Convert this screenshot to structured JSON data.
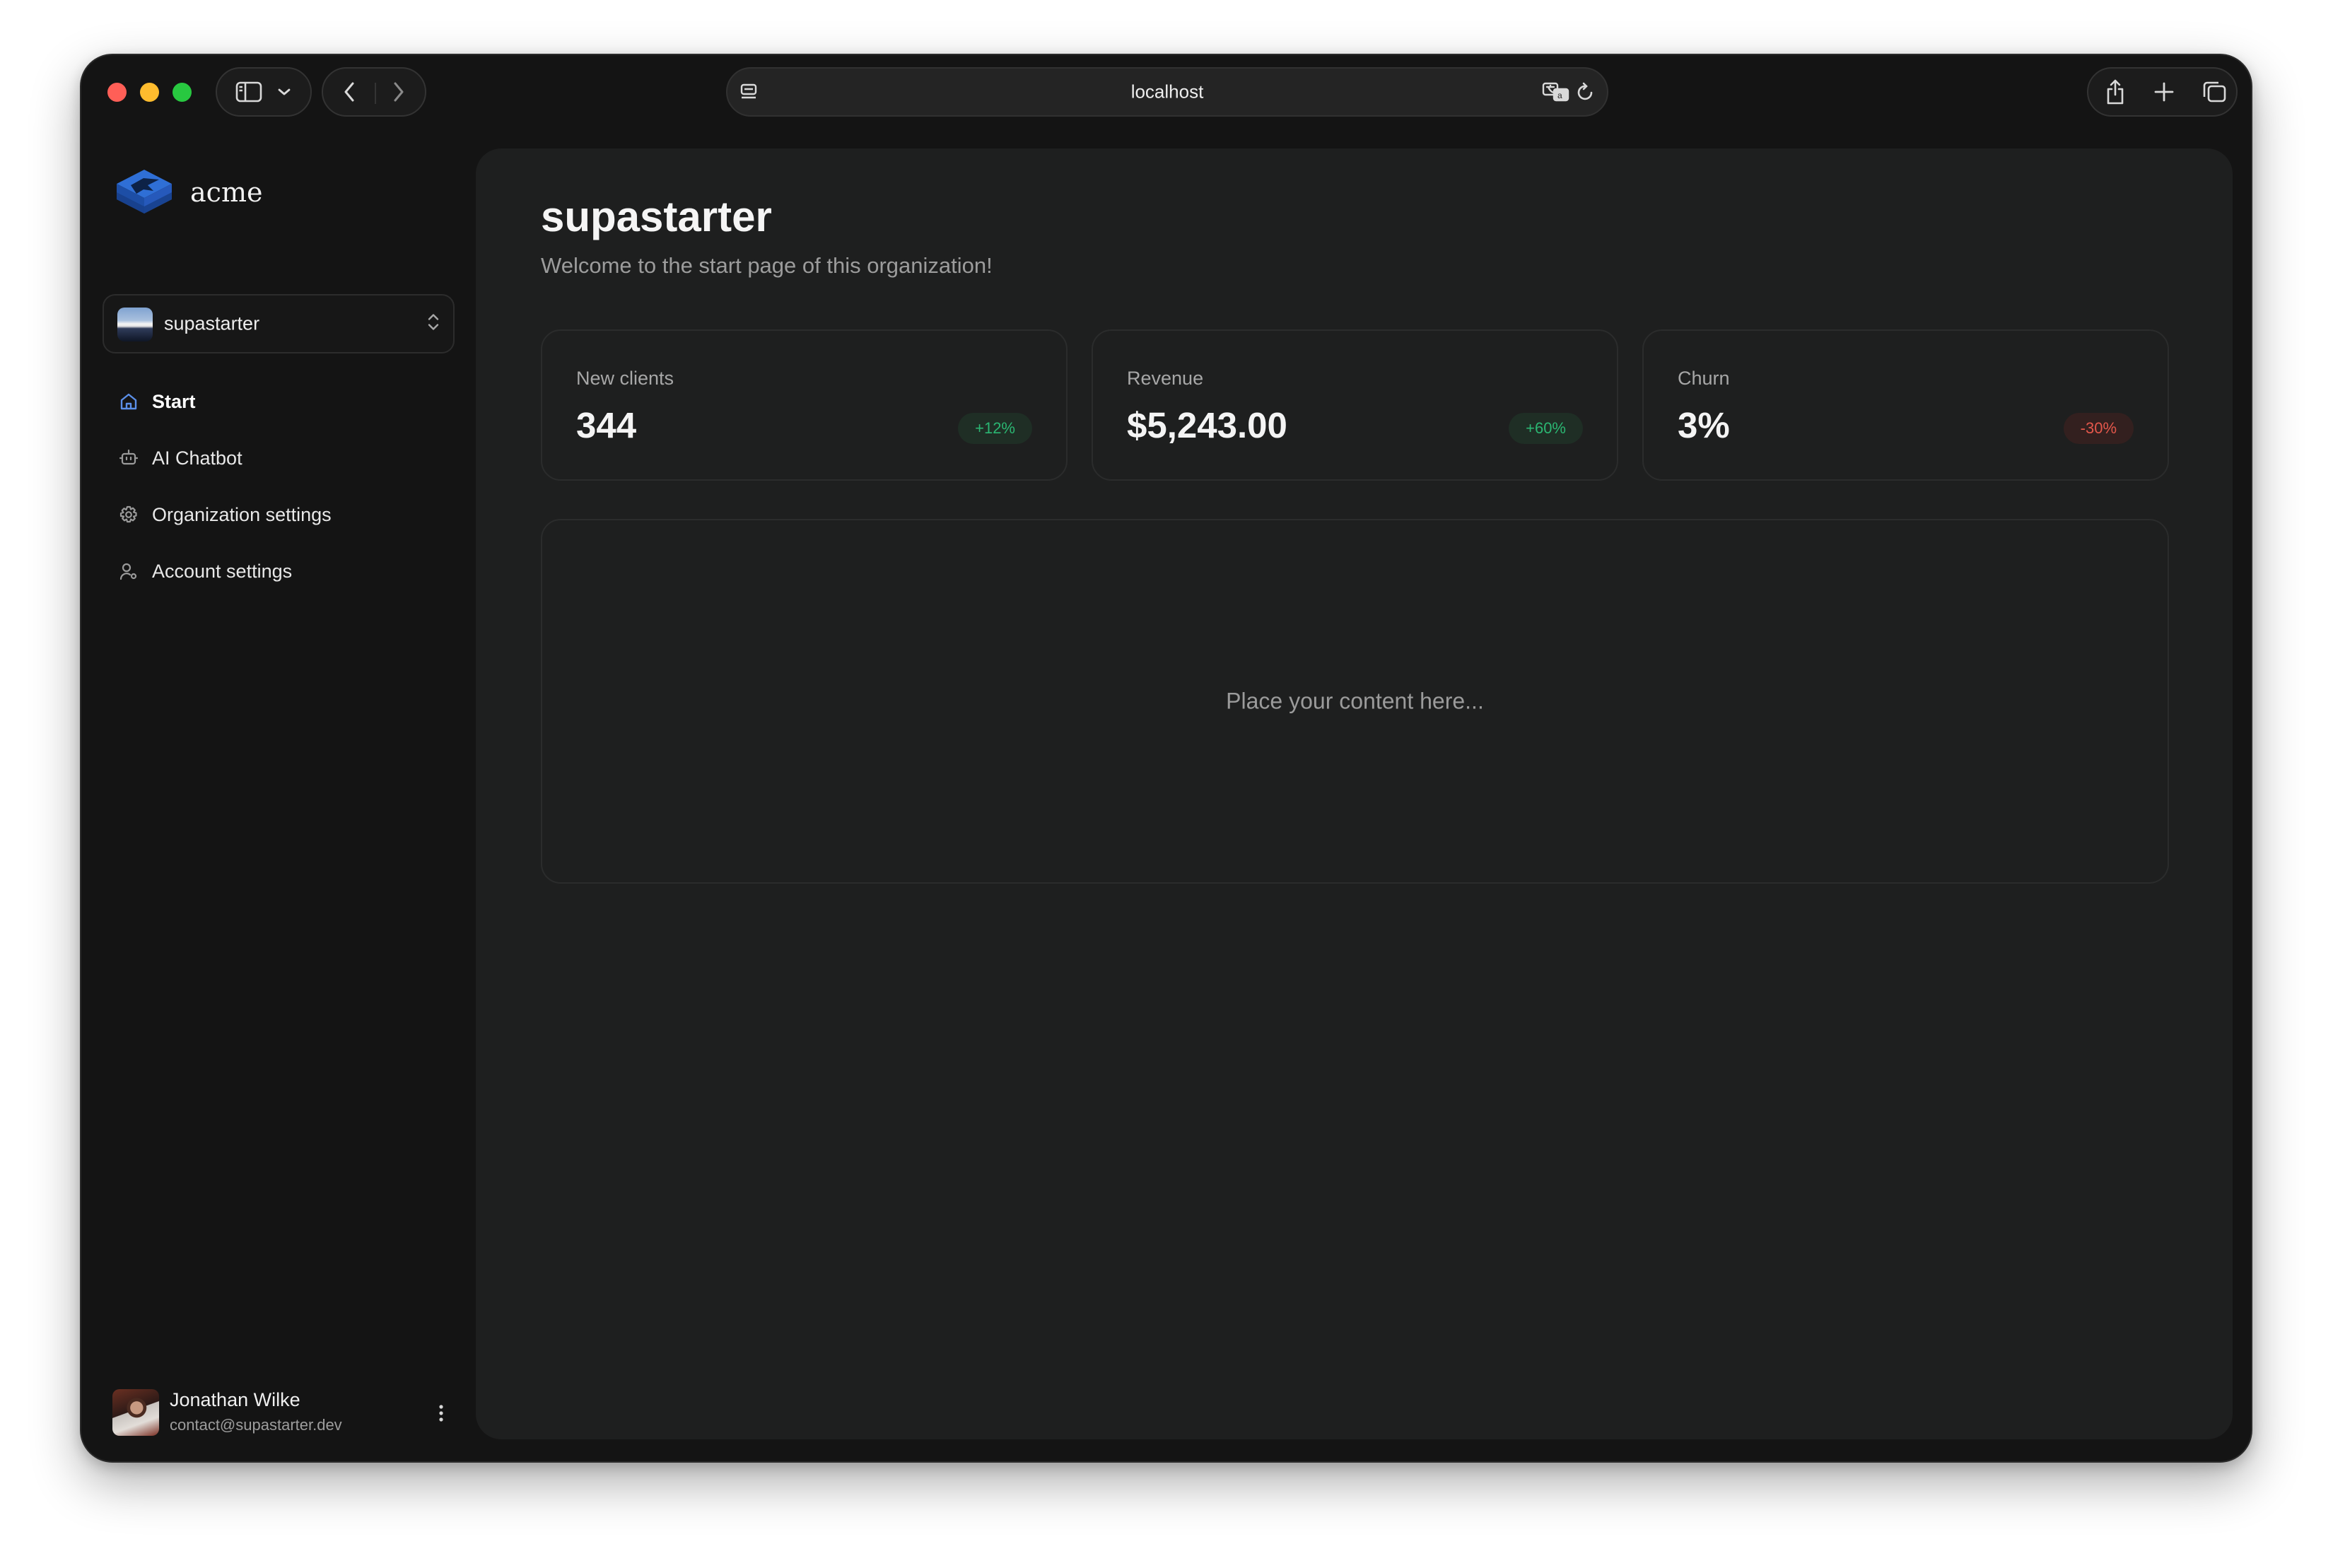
{
  "browser": {
    "url": "localhost",
    "icons": [
      "sidebar-icon",
      "chevron-down-icon",
      "back-icon",
      "forward-icon",
      "page-settings-icon",
      "translate-icon",
      "reload-icon",
      "share-icon",
      "new-tab-icon",
      "tabs-overview-icon"
    ]
  },
  "sidebar": {
    "brand_name": "acme",
    "organization": {
      "name": "supastarter"
    },
    "nav": [
      {
        "label": "Start",
        "icon": "home-icon",
        "active": true
      },
      {
        "label": "AI Chatbot",
        "icon": "bot-icon",
        "active": false
      },
      {
        "label": "Organization settings",
        "icon": "gear-icon",
        "active": false
      },
      {
        "label": "Account settings",
        "icon": "user-cog-icon",
        "active": false
      }
    ],
    "user": {
      "name": "Jonathan Wilke",
      "email": "contact@supastarter.dev"
    }
  },
  "main": {
    "title": "supastarter",
    "subtitle": "Welcome to the start page of this organization!",
    "stats": [
      {
        "label": "New clients",
        "value": "344",
        "change": "+12%",
        "trend": "up"
      },
      {
        "label": "Revenue",
        "value": "$5,243.00",
        "change": "+60%",
        "trend": "up"
      },
      {
        "label": "Churn",
        "value": "3%",
        "change": "-30%",
        "trend": "down"
      }
    ],
    "content_placeholder": "Place your content here..."
  },
  "colors": {
    "accent": "#5b8fe8",
    "positive": "#2bb672",
    "negative": "#e3574b",
    "background": "#141414",
    "panel": "#1e1f1f"
  }
}
